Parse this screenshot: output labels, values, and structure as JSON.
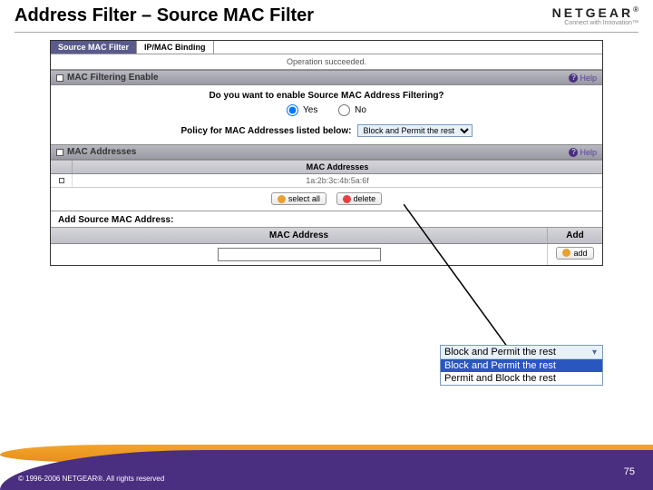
{
  "header": {
    "title": "Address Filter – Source MAC Filter",
    "logo_text": "NETGEAR",
    "logo_reg": "®",
    "logo_tagline": "Connect with Innovation™"
  },
  "tabs": {
    "items": [
      {
        "label": "Source MAC Filter",
        "active": true
      },
      {
        "label": "IP/MAC Binding",
        "active": false
      }
    ]
  },
  "status": {
    "message": "Operation succeeded."
  },
  "filter_section": {
    "title": "MAC Filtering Enable",
    "help": "Help",
    "question": "Do you want to enable Source MAC Address Filtering?",
    "yes": "Yes",
    "no": "No",
    "policy_label": "Policy for MAC Addresses listed below:",
    "policy_select": "Block and Permit the rest"
  },
  "mac_section": {
    "title": "MAC Addresses",
    "help": "Help",
    "col_header": "MAC Addresses",
    "row_value": "1a:2b:3c:4b:5a:6f",
    "select_all": "select all",
    "delete": "delete"
  },
  "add_section": {
    "label": "Add Source MAC Address:",
    "col_mac": "MAC Address",
    "col_add": "Add",
    "add_btn": "add"
  },
  "callout": {
    "top": "Block and Permit the rest",
    "opt1": "Block and Permit the rest",
    "opt2": "Permit and Block the rest"
  },
  "footer": {
    "copyright": "© 1996-2006 NETGEAR®. All rights reserved",
    "page": "75"
  }
}
